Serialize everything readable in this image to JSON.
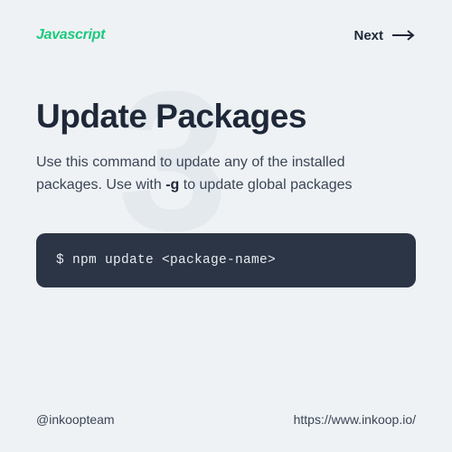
{
  "header": {
    "brand": "Javascript",
    "next_label": "Next"
  },
  "main": {
    "bg_number": "3",
    "title": "Update Packages",
    "desc_part1": "Use this command to update any of the installed packages. Use with ",
    "desc_flag": "-g",
    "desc_part2": " to update global packages",
    "code": "$ npm update <package-name>"
  },
  "footer": {
    "handle": "@inkoopteam",
    "url": "https://www.inkoop.io/"
  }
}
